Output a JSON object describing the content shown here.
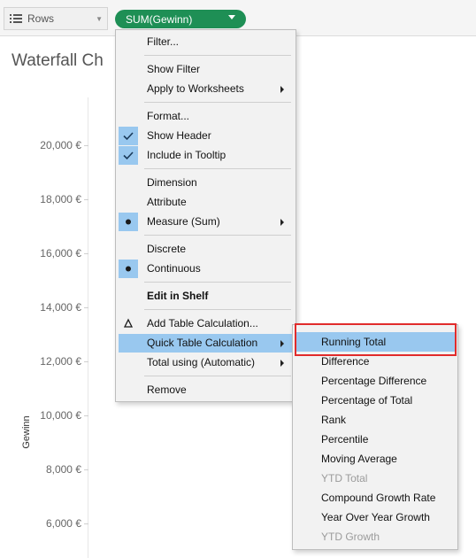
{
  "shelf": {
    "rows_label": "Rows",
    "rows_icon": "rows-list-icon",
    "pill_label": "SUM(Gewinn)",
    "pill_color": "#1e8f55"
  },
  "worksheet": {
    "title": "Waterfall Ch",
    "y_axis_label": "Gewinn",
    "y_ticks": [
      "20,000 €",
      "18,000 €",
      "16,000 €",
      "14,000 €",
      "12,000 €",
      "10,000 €",
      "8,000 €",
      "6,000 €"
    ]
  },
  "context_menu": {
    "items": [
      {
        "label": "Filter..."
      },
      {
        "label": "Show Filter"
      },
      {
        "label": "Apply to Worksheets",
        "submenu": true
      },
      {
        "label": "Format..."
      },
      {
        "label": "Show Header",
        "icon": "checkmark-icon"
      },
      {
        "label": "Include in Tooltip",
        "icon": "checkmark-icon"
      },
      {
        "label": "Dimension"
      },
      {
        "label": "Attribute"
      },
      {
        "label": "Measure (Sum)",
        "icon": "bullet-icon",
        "submenu": true
      },
      {
        "label": "Discrete"
      },
      {
        "label": "Continuous",
        "icon": "bullet-icon"
      },
      {
        "label": "Edit in Shelf"
      },
      {
        "label": "Add Table Calculation...",
        "icon": "delta-icon"
      },
      {
        "label": "Quick Table Calculation",
        "submenu": true,
        "highlighted": true
      },
      {
        "label": "Total using (Automatic)",
        "submenu": true
      },
      {
        "label": "Remove"
      }
    ]
  },
  "quick_table_calc_submenu": {
    "items": [
      {
        "label": "Running Total",
        "highlighted": true
      },
      {
        "label": "Difference"
      },
      {
        "label": "Percentage Difference"
      },
      {
        "label": "Percentage of Total"
      },
      {
        "label": "Rank"
      },
      {
        "label": "Percentile"
      },
      {
        "label": "Moving Average"
      },
      {
        "label": "YTD Total",
        "disabled": true
      },
      {
        "label": "Compound Growth Rate"
      },
      {
        "label": "Year Over Year Growth"
      },
      {
        "label": "YTD Growth",
        "disabled": true
      }
    ]
  },
  "colors": {
    "highlight": "#99c8ef",
    "annotation_box": "#e12b2b"
  }
}
